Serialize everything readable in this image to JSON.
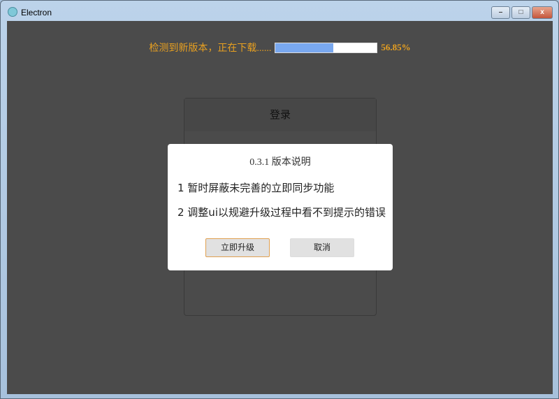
{
  "window": {
    "title": "Electron",
    "minimize": "–",
    "maximize": "□",
    "close": "x"
  },
  "update": {
    "message": "检测到新版本，正在下载......",
    "progress_percent": 56.85,
    "progress_label": "56.85%",
    "accent": "#e8a020",
    "fill_color": "#79a8ef"
  },
  "login": {
    "title": "登录"
  },
  "dialog": {
    "title": "0.3.1 版本说明",
    "items": [
      "1  暂时屏蔽未完善的立即同步功能",
      "2  调整ui以规避升级过程中看不到提示的错误"
    ],
    "confirm_label": "立即升级",
    "cancel_label": "取消"
  }
}
